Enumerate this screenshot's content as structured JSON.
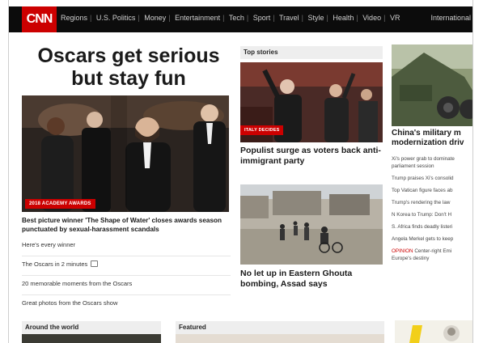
{
  "nav": {
    "logo": "CNN",
    "items": [
      "Regions",
      "U.S. Politics",
      "Money",
      "Entertainment",
      "Tech",
      "Sport",
      "Travel",
      "Style",
      "Health",
      "Video",
      "VR"
    ],
    "right_label": "International"
  },
  "lead": {
    "headline_line1": "Oscars get serious",
    "headline_line2": "but stay fun",
    "badge": "2018 ACADEMY AWARDS",
    "title": "Best picture winner 'The Shape of Water' closes awards season punctuated by sexual-harassment scandals",
    "links": [
      "Here's every winner",
      "The Oscars in 2 minutes",
      "20 memorable moments from the Oscars",
      "Great photos from the Oscars show"
    ]
  },
  "top_stories": {
    "header": "Top stories",
    "story1": {
      "badge": "ITALY DECIDES",
      "title": "Populist surge as voters back anti-immigrant party"
    },
    "story2": {
      "title": "No let up in Eastern Ghouta bombing, Assad says"
    }
  },
  "right": {
    "title_line1": "China's military m",
    "title_line2": "modernization driv",
    "links": [
      "Xi's power grab to dominate",
      "parliament session",
      "Trump praises Xi's consolid",
      "Top Vatican figure faces ab",
      "Trump's rendering the law",
      "N Korea to Trump: Don't H",
      "S. Africa finds deadly listeri",
      "Angela Merkel gets to keep"
    ],
    "opinion_label": "OPINION",
    "opinion_text": "Center-right Emi",
    "last_line": "Europe's destiny"
  },
  "bottom": {
    "around_world": "Around the world",
    "featured": "Featured"
  },
  "colors": {
    "brand_red": "#cc0000",
    "nav_bg": "#0c0c0c"
  }
}
